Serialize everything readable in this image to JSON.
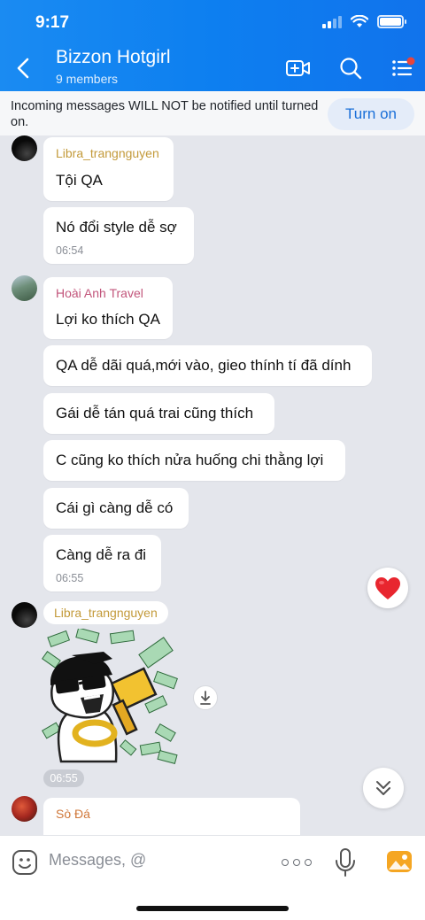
{
  "status_bar": {
    "time": "9:17"
  },
  "header": {
    "title": "Bizzon Hotgirl",
    "subtitle": "9 members"
  },
  "banner": {
    "text": "Incoming messages WILL NOT be notified until turned on.",
    "button_label": "Turn on"
  },
  "messages": [
    {
      "sender": "Libra_trangnguyen",
      "text": "Tội QA"
    },
    {
      "text": "Nó đổi style dễ sợ",
      "time": "06:54"
    },
    {
      "sender": "Hoài Anh Travel",
      "text": "Lợi ko thích QA"
    },
    {
      "text": "QA dễ dãi quá,mới vào, gieo thính tí đã dính"
    },
    {
      "text": "Gái dễ tán quá trai cũng thích"
    },
    {
      "text": "C cũng ko thích nửa huống chi thằng lợi"
    },
    {
      "text": "Cái gì càng dễ có"
    },
    {
      "text": "Càng dễ ra đi",
      "time": "06:55"
    },
    {
      "sender": "Libra_trangnguyen",
      "sticker_time": "06:55"
    },
    {
      "sender": "Sò Đá"
    }
  ],
  "composer": {
    "placeholder": "Messages, @"
  },
  "icons": {
    "back": "chevron-left-icon",
    "video": "video-call-icon",
    "search": "search-icon",
    "menu": "list-menu-icon",
    "heart": "heart-icon",
    "scroll_down": "double-chevron-down-icon",
    "download": "download-icon",
    "emoji": "emoji-icon",
    "more": "more-icon",
    "mic": "microphone-icon",
    "photo": "photo-icon"
  },
  "colors": {
    "header": "#1a8bf2",
    "accent": "#1a6fd8",
    "notification_dot": "#e8453c",
    "heart": "#e8262f"
  }
}
